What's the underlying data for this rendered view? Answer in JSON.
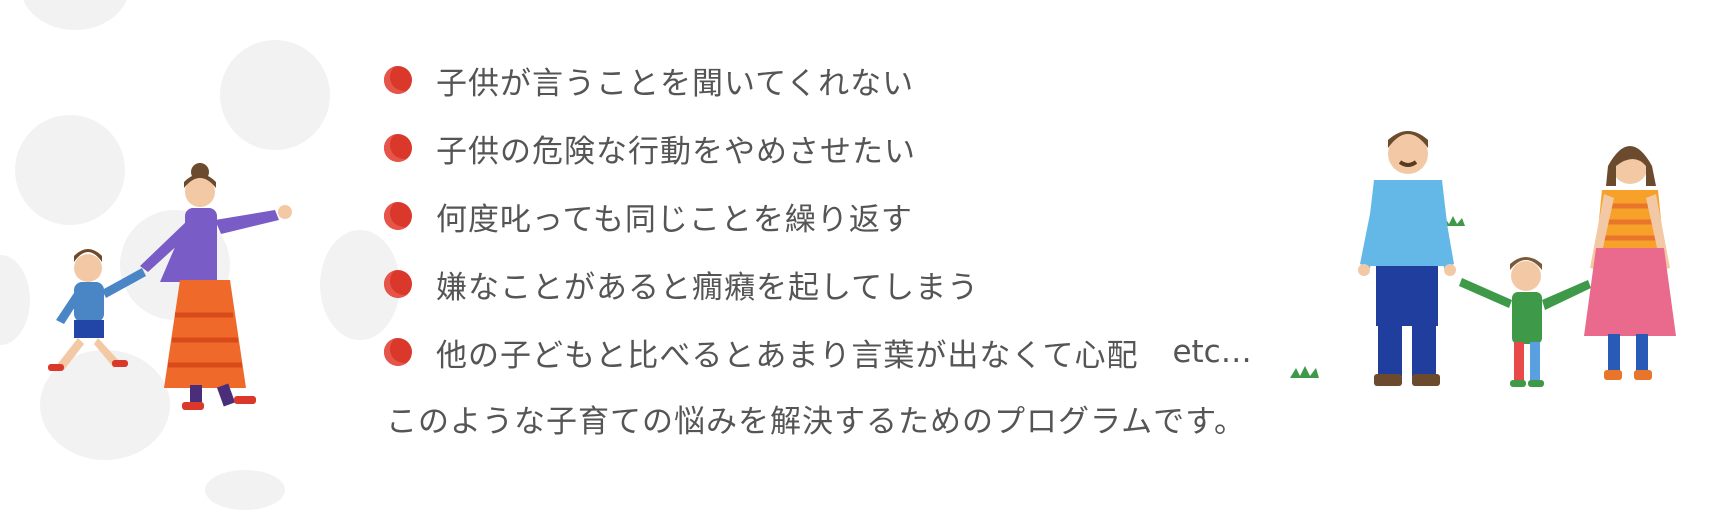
{
  "concerns": [
    "子供が言うことを聞いてくれない",
    "子供の危険な行動をやめさせたい",
    "何度叱っても同じことを繰り返す",
    "嫌なことがあると癇癪を起してしまう",
    "他の子どもと比べるとあまり言葉が出なくて心配"
  ],
  "etc_label": "etc…",
  "closing": "このような子育ての悩みを解決するためのプログラムです。",
  "colors": {
    "bullet": "#d9382b",
    "text": "#555555",
    "blob": "#f2f2f2"
  },
  "icons": [
    "mother-child-walking-illustration",
    "family-holding-hands-illustration"
  ]
}
